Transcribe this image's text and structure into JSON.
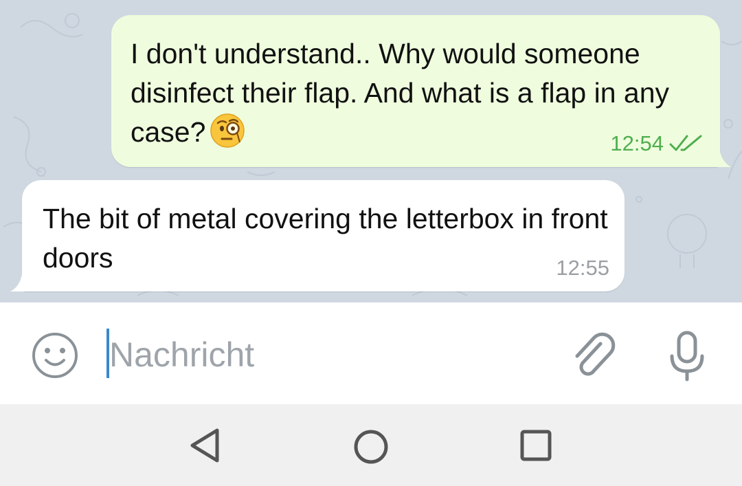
{
  "chat": {
    "messages": [
      {
        "direction": "outgoing",
        "text": "I don't understand.. Why would someone disinfect their flap. And what is a flap in any case?",
        "emoji": "face-with-monocle",
        "time": "12:54",
        "status": "read-double-check"
      },
      {
        "direction": "incoming",
        "text": "The bit of metal covering the letterbox in front doors",
        "time": "12:55"
      }
    ]
  },
  "composer": {
    "placeholder": "Nachricht",
    "icons": {
      "emoji": "smiley-icon",
      "attach": "paperclip-icon",
      "voice": "microphone-icon"
    }
  },
  "navigation": {
    "icons": [
      "back-triangle-icon",
      "home-circle-icon",
      "recents-square-icon"
    ]
  },
  "colors": {
    "chat_background": "#cfd8e1",
    "outgoing_bubble": "#effdde",
    "incoming_bubble": "#ffffff",
    "read_check": "#4fae4e",
    "caret": "#3a89c9"
  }
}
